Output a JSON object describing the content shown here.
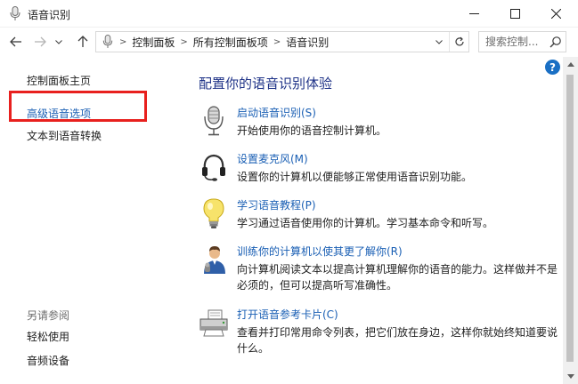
{
  "window": {
    "title": "语音识别"
  },
  "nav": {
    "breadcrumb": [
      "控制面板",
      "所有控制面板项",
      "语音识别"
    ],
    "search_placeholder": "搜索控制..."
  },
  "sidebar": {
    "home": "控制面板主页",
    "advanced": "高级语音选项",
    "tts": "文本到语音转换",
    "see_also": "另请参阅",
    "ease_of_access": "轻松使用",
    "audio_devices": "音频设备"
  },
  "main": {
    "title": "配置你的语音识别体验",
    "tasks": [
      {
        "icon": "microphone-icon",
        "link": "启动语音识别(S)",
        "desc": "开始使用你的语音控制计算机。"
      },
      {
        "icon": "headset-icon",
        "link": "设置麦克风(M)",
        "desc": "设置你的计算机以便能够正常使用语音识别功能。"
      },
      {
        "icon": "lightbulb-icon",
        "link": "学习语音教程(P)",
        "desc": "学习通过语音使用你的计算机。学习基本命令和听写。"
      },
      {
        "icon": "user-speaking-icon",
        "link": "训练你的计算机以使其更了解你(R)",
        "desc": "向计算机阅读文本以提高计算机理解你的语音的能力。这样做并不是必须的，但可以提高听写准确性。"
      },
      {
        "icon": "printer-icon",
        "link": "打开语音参考卡片(C)",
        "desc": "查看并打印常用命令列表，把它们放在身边，这样你就始终知道要说什么。"
      }
    ]
  },
  "help": {
    "label": "?"
  },
  "colors": {
    "link": "#1a5fb4",
    "title": "#1e3287",
    "highlight": "#e8201e",
    "help": "#1a6fc4"
  }
}
